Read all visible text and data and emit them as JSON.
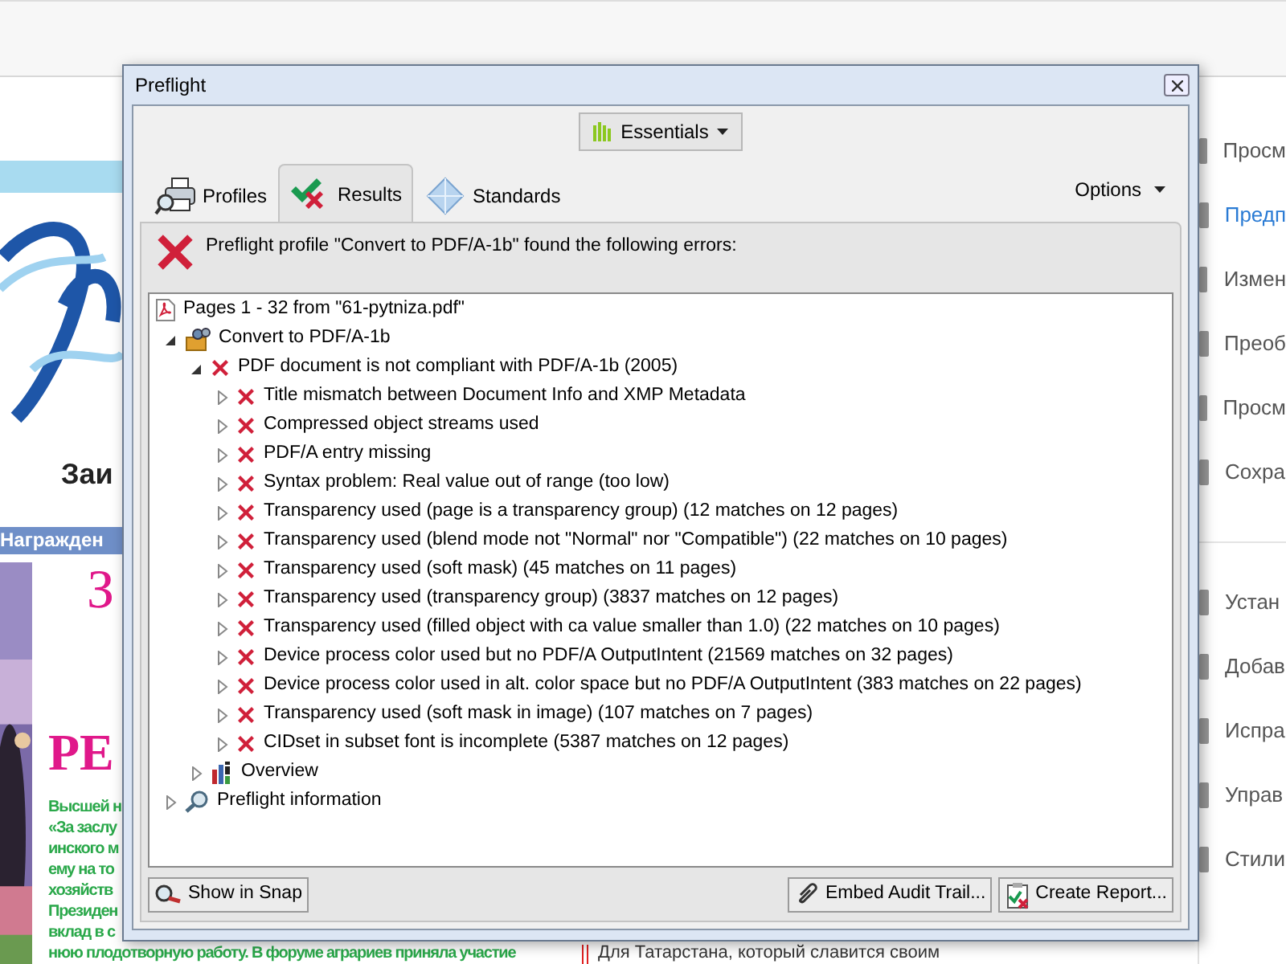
{
  "document": {
    "heading_fragment": "Заи",
    "band_text": "Награжден",
    "big_letter": "З",
    "big_word": "РЕ",
    "green_lines": [
      "Высшей н",
      "«За заслу",
      "инского м",
      "ему на то",
      "хозяйств",
      "Президен",
      "вклад в с",
      "нюю плодотворную работу. В форуме аграриев приняла участие"
    ],
    "right_column_line": "Для Татарстана, который славится своим"
  },
  "tools_panel": {
    "groups": [
      [
        {
          "label": "Просм",
          "selected": false
        },
        {
          "label": "Предп",
          "selected": true
        },
        {
          "label": "Измен",
          "selected": false
        },
        {
          "label": "Преоб",
          "selected": false
        },
        {
          "label": "Просм",
          "selected": false
        },
        {
          "label": "Сохра",
          "selected": false
        }
      ],
      [
        {
          "label": "Устан",
          "selected": false
        },
        {
          "label": "Добав",
          "selected": false
        },
        {
          "label": "Испра",
          "selected": false
        },
        {
          "label": "Управ",
          "selected": false
        },
        {
          "label": "Стили",
          "selected": false
        }
      ]
    ]
  },
  "dialog": {
    "title": "Preflight",
    "mode_button": "Essentials",
    "tabs": [
      {
        "label": "Profiles",
        "kind": "profiles",
        "selected": false
      },
      {
        "label": "Results",
        "kind": "results",
        "selected": true
      },
      {
        "label": "Standards",
        "kind": "standards",
        "selected": false
      }
    ],
    "options": "Options",
    "message": "Preflight profile \"Convert to PDF/A-1b\" found the following errors:",
    "tree": [
      {
        "label": "Pages 1 - 32 from \"61-pytniza.pdf\"",
        "kind": "pdf",
        "children": [
          {
            "label": "Convert to PDF/A-1b",
            "kind": "profile",
            "expanded": true,
            "children": [
              {
                "label": "PDF document is not compliant with PDF/A-1b (2005)",
                "kind": "error",
                "expanded": true,
                "children": [
                  {
                    "label": "Title mismatch between Document Info and XMP Metadata",
                    "kind": "error",
                    "expanded": false
                  },
                  {
                    "label": "Compressed object streams used",
                    "kind": "error",
                    "expanded": false
                  },
                  {
                    "label": "PDF/A entry missing",
                    "kind": "error",
                    "expanded": false
                  },
                  {
                    "label": "Syntax problem: Real value out of range (too low)",
                    "kind": "error",
                    "expanded": false
                  },
                  {
                    "label": "Transparency used (page is a transparency group) (12 matches on 12 pages)",
                    "kind": "error",
                    "expanded": false
                  },
                  {
                    "label": "Transparency used (blend mode not \"Normal\" nor \"Compatible\") (22 matches on 10 pages)",
                    "kind": "error",
                    "expanded": false
                  },
                  {
                    "label": "Transparency used (soft mask) (45 matches on 11 pages)",
                    "kind": "error",
                    "expanded": false
                  },
                  {
                    "label": "Transparency used (transparency group) (3837 matches on 12 pages)",
                    "kind": "error",
                    "expanded": false
                  },
                  {
                    "label": "Transparency used (filled object with ca value smaller than 1.0) (22 matches on 10 pages)",
                    "kind": "error",
                    "expanded": false
                  },
                  {
                    "label": "Device process color used but no PDF/A OutputIntent (21569 matches on 32 pages)",
                    "kind": "error",
                    "expanded": false
                  },
                  {
                    "label": "Device process color used in alt. color space but no PDF/A OutputIntent (383 matches on 22 pages)",
                    "kind": "error",
                    "expanded": false
                  },
                  {
                    "label": "Transparency used (soft mask in image) (107 matches on 7 pages)",
                    "kind": "error",
                    "expanded": false
                  },
                  {
                    "label": "CIDset in subset font is incomplete (5387 matches on 12 pages)",
                    "kind": "error",
                    "expanded": false
                  }
                ]
              },
              {
                "label": "Overview",
                "kind": "overview",
                "expanded": false
              }
            ]
          },
          {
            "label": "Preflight information",
            "kind": "info",
            "expanded": false
          }
        ]
      }
    ],
    "buttons": [
      {
        "label": "Show in Snap",
        "kind": "snap"
      },
      {
        "label": "Embed Audit Trail...",
        "kind": "embed"
      },
      {
        "label": "Create Report...",
        "kind": "report"
      }
    ]
  }
}
